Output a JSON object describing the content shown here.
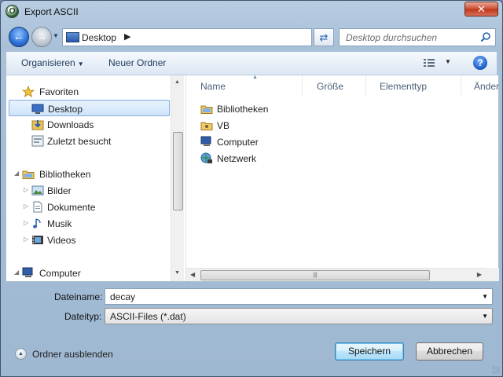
{
  "window": {
    "title": "Export ASCII",
    "close_label": "✕",
    "app_icon_glyph": "O"
  },
  "nav": {
    "path_root": "Desktop",
    "search_placeholder": "Desktop durchsuchen"
  },
  "toolbar": {
    "organize_label": "Organisieren",
    "new_folder_label": "Neuer Ordner",
    "help_label": "?"
  },
  "sidebar": {
    "items": [
      {
        "label": "Favoriten",
        "icon": "star-icon"
      },
      {
        "label": "Desktop",
        "icon": "desktop-icon",
        "selected": true
      },
      {
        "label": "Downloads",
        "icon": "downloads-icon"
      },
      {
        "label": "Zuletzt besucht",
        "icon": "recent-places-icon"
      },
      {
        "label": "Bibliotheken",
        "icon": "libraries-icon"
      },
      {
        "label": "Bilder",
        "icon": "pictures-icon"
      },
      {
        "label": "Dokumente",
        "icon": "documents-icon"
      },
      {
        "label": "Musik",
        "icon": "music-icon"
      },
      {
        "label": "Videos",
        "icon": "videos-icon"
      },
      {
        "label": "Computer",
        "icon": "computer-icon"
      }
    ]
  },
  "files": {
    "columns": [
      "Name",
      "Größe",
      "Elementtyp",
      "Änder"
    ],
    "items": [
      {
        "name": "Bibliotheken",
        "icon": "libraries-icon"
      },
      {
        "name": "VB",
        "icon": "user-folder-icon"
      },
      {
        "name": "Computer",
        "icon": "computer-icon"
      },
      {
        "name": "Netzwerk",
        "icon": "network-icon"
      }
    ]
  },
  "form": {
    "filename_label": "Dateiname:",
    "filename_value": "decay",
    "filetype_label": "Dateityp:",
    "filetype_value": "ASCII-Files (*.dat)"
  },
  "footer": {
    "hide_folders_label": "Ordner ausblenden",
    "save_label": "Speichern",
    "cancel_label": "Abbrechen"
  },
  "colors": {
    "accent": "#3c7fb1",
    "selection": "#cfe4fb",
    "close_button": "#c13a1e"
  }
}
